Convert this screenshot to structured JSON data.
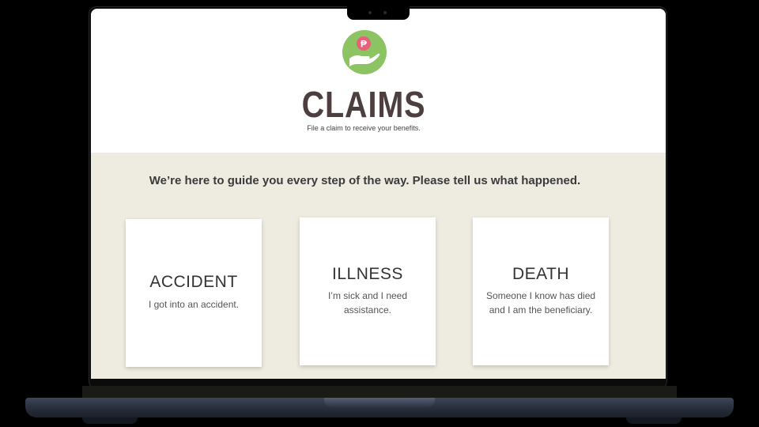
{
  "header": {
    "logo_icon": "hand-holding-coin-icon",
    "logo_symbol": "₱",
    "title": "CLAIMS",
    "subtitle": "File a claim to receive your benefits."
  },
  "main": {
    "guide_text": "We’re here to guide you every step of the way. Please tell us what happened.",
    "cards": [
      {
        "title": "ACCIDENT",
        "description": "I got into an accident."
      },
      {
        "title": "ILLNESS",
        "description": "I’m sick and I need assistance."
      },
      {
        "title": "DEATH",
        "description": "Someone I know has died and I am the beneficiary."
      }
    ]
  },
  "colors": {
    "logo_green": "#8cc363",
    "coin_pink": "#e8607a",
    "title_brown": "#4d3f3f",
    "body_background": "#eeebe0"
  }
}
